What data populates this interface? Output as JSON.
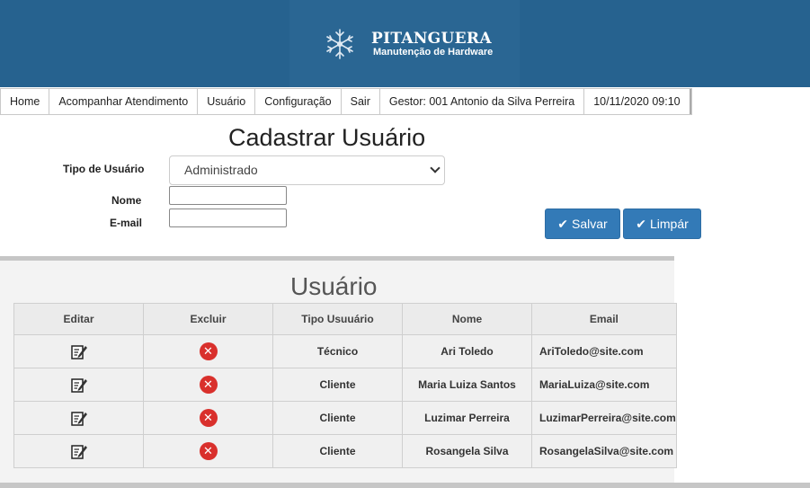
{
  "header": {
    "brand_name": "PITANGUERA",
    "brand_sub": "Manutenção de Hardware",
    "logo_icon": "snowflake-icon",
    "banner_color": "#26628f"
  },
  "nav": {
    "home": "Home",
    "acompanhar": "Acompanhar Atendimento",
    "usuario": "Usuário",
    "configuracao": "Configuração",
    "sair": "Sair",
    "gestor": "Gestor: 001 Antonio da Silva Perreira",
    "datetime": "10/11/2020 09:10"
  },
  "form": {
    "title": "Cadastrar Usuário",
    "tipo_label": "Tipo de Usuário",
    "tipo_value": "Administrado",
    "nome_label": "Nome",
    "nome_value": "",
    "email_label": "E-mail",
    "email_value": "",
    "save_label": "Salvar",
    "clear_label": "Limpár",
    "button_color": "#337ab7"
  },
  "users": {
    "title": "Usuário",
    "columns": [
      "Editar",
      "Excluir",
      "Tipo Usuuário",
      "Nome",
      "Email"
    ],
    "rows": [
      {
        "tipo": "Técnico",
        "nome": "Ari Toledo",
        "email": "AriToledo@site.com"
      },
      {
        "tipo": "Cliente",
        "nome": "Maria Luiza Santos",
        "email": "MariaLuiza@site.com"
      },
      {
        "tipo": "Cliente",
        "nome": "Luzimar Perreira",
        "email": "LuzimarPerreira@site.com"
      },
      {
        "tipo": "Cliente",
        "nome": "Rosangela Silva",
        "email": "RosangelaSilva@site.com"
      }
    ],
    "edit_icon": "edit-icon",
    "delete_icon": "delete-icon",
    "delete_color": "#d9302c"
  }
}
